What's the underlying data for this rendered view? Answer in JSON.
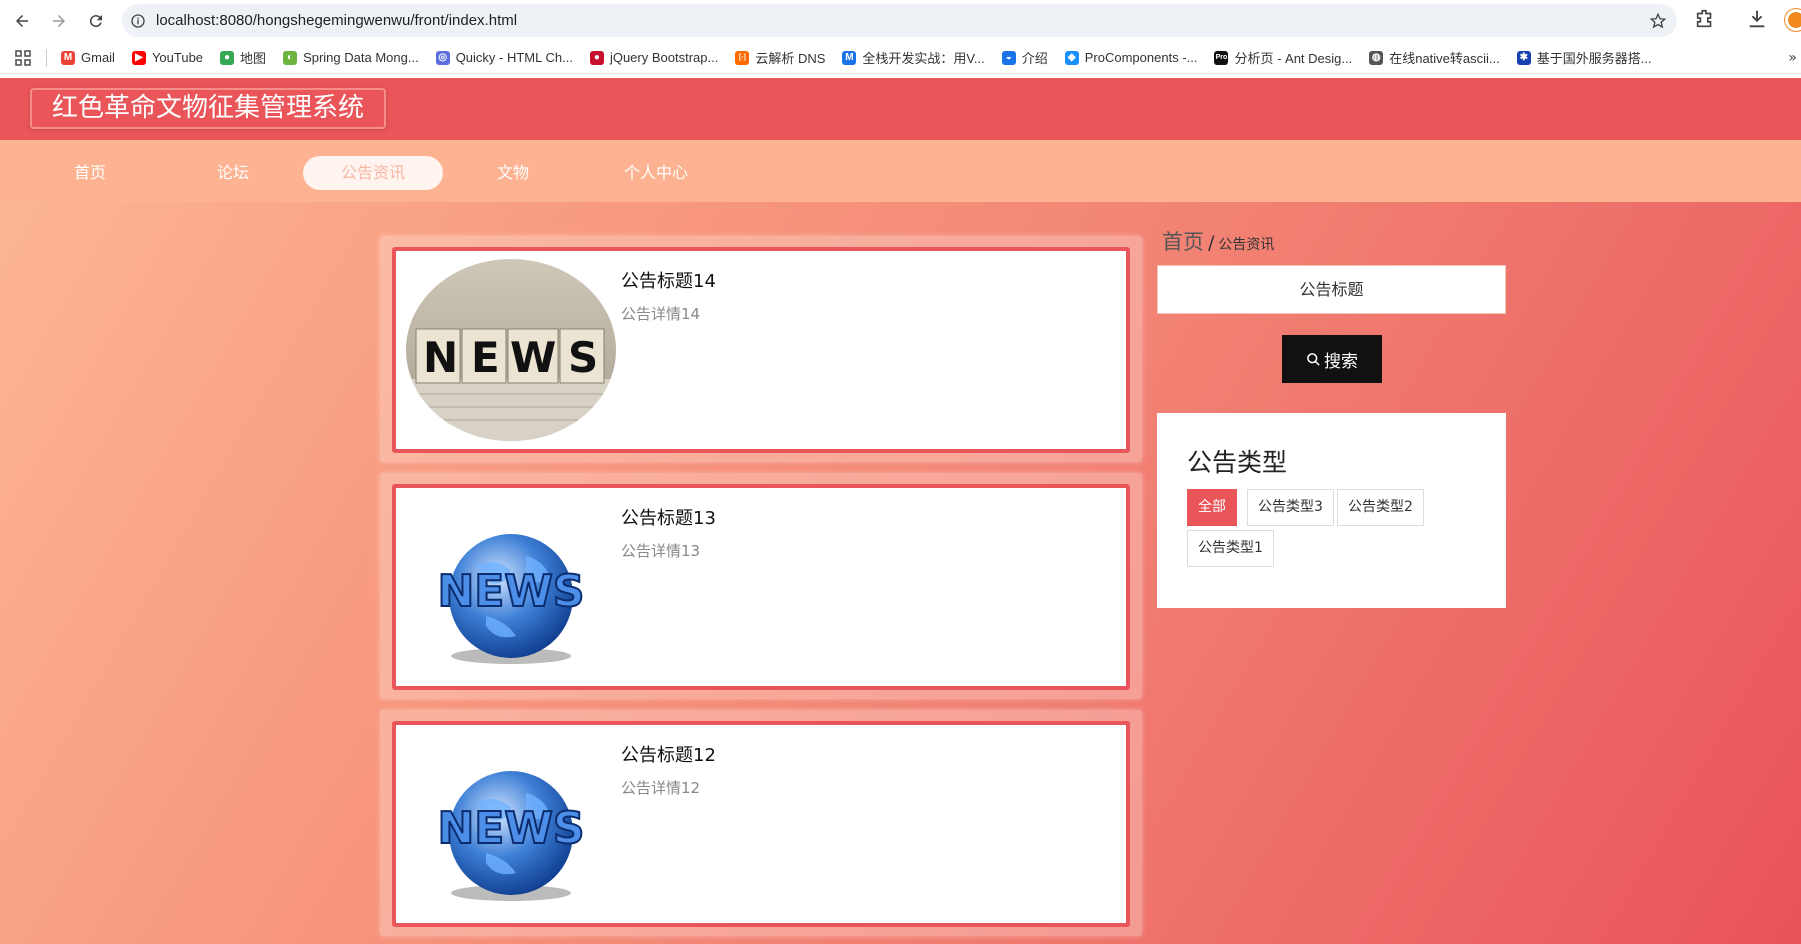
{
  "browser": {
    "url": "localhost:8080/hongshegemingwenwu/front/index.html",
    "bookmarks": [
      {
        "label": "Gmail",
        "icon": "gmail-icon",
        "color": "#ea4335",
        "glyph": "M"
      },
      {
        "label": "YouTube",
        "icon": "youtube-icon",
        "color": "#ff0000",
        "glyph": "▶"
      },
      {
        "label": "地图",
        "icon": "maps-icon",
        "color": "#34a853",
        "glyph": "●"
      },
      {
        "label": "Spring Data Mong...",
        "icon": "spring-icon",
        "color": "#6db33f",
        "glyph": "◐"
      },
      {
        "label": "Quicky - HTML Ch...",
        "icon": "quicky-icon",
        "color": "#5b6ee1",
        "glyph": "◎"
      },
      {
        "label": "jQuery Bootstrap...",
        "icon": "jquery-icon",
        "color": "#c8102e",
        "glyph": "●"
      },
      {
        "label": "云解析 DNS",
        "icon": "aliyun-icon",
        "color": "#ff6a00",
        "glyph": "[-]"
      },
      {
        "label": "全栈开发实战：用V...",
        "icon": "m-icon",
        "color": "#1a73e8",
        "glyph": "M"
      },
      {
        "label": "介绍",
        "icon": "globe-icon",
        "color": "#1a73e8",
        "glyph": "◒"
      },
      {
        "label": "ProComponents -...",
        "icon": "procomponents-icon",
        "color": "#1890ff",
        "glyph": "◆"
      },
      {
        "label": "分析页 - Ant Desig...",
        "icon": "pro-icon",
        "color": "#111111",
        "glyph": "Pro"
      },
      {
        "label": "在线native转ascii...",
        "icon": "web-icon",
        "color": "#555555",
        "glyph": "◍"
      },
      {
        "label": "基于国外服务器搭...",
        "icon": "snowflake-icon",
        "color": "#1a3fb0",
        "glyph": "✱"
      }
    ]
  },
  "site": {
    "title": "红色革命文物征集管理系统",
    "nav": [
      "首页",
      "论坛",
      "公告资讯",
      "文物",
      "个人中心"
    ],
    "active_nav": "公告资讯",
    "accent_color": "#e95559"
  },
  "news": [
    {
      "title": "公告标题14",
      "desc": "公告详情14",
      "image": "news-cubes-image"
    },
    {
      "title": "公告标题13",
      "desc": "公告详情13",
      "image": "news-globe-image"
    },
    {
      "title": "公告标题12",
      "desc": "公告详情12",
      "image": "news-globe-image"
    }
  ],
  "sidebar": {
    "breadcrumb_home": "首页",
    "breadcrumb_sep": "/",
    "breadcrumb_current": "公告资讯",
    "search_placeholder": "公告标题",
    "search_button": "搜索",
    "types_title": "公告类型",
    "types": [
      "全部",
      "公告类型3",
      "公告类型2",
      "公告类型1"
    ],
    "active_type": "全部"
  }
}
